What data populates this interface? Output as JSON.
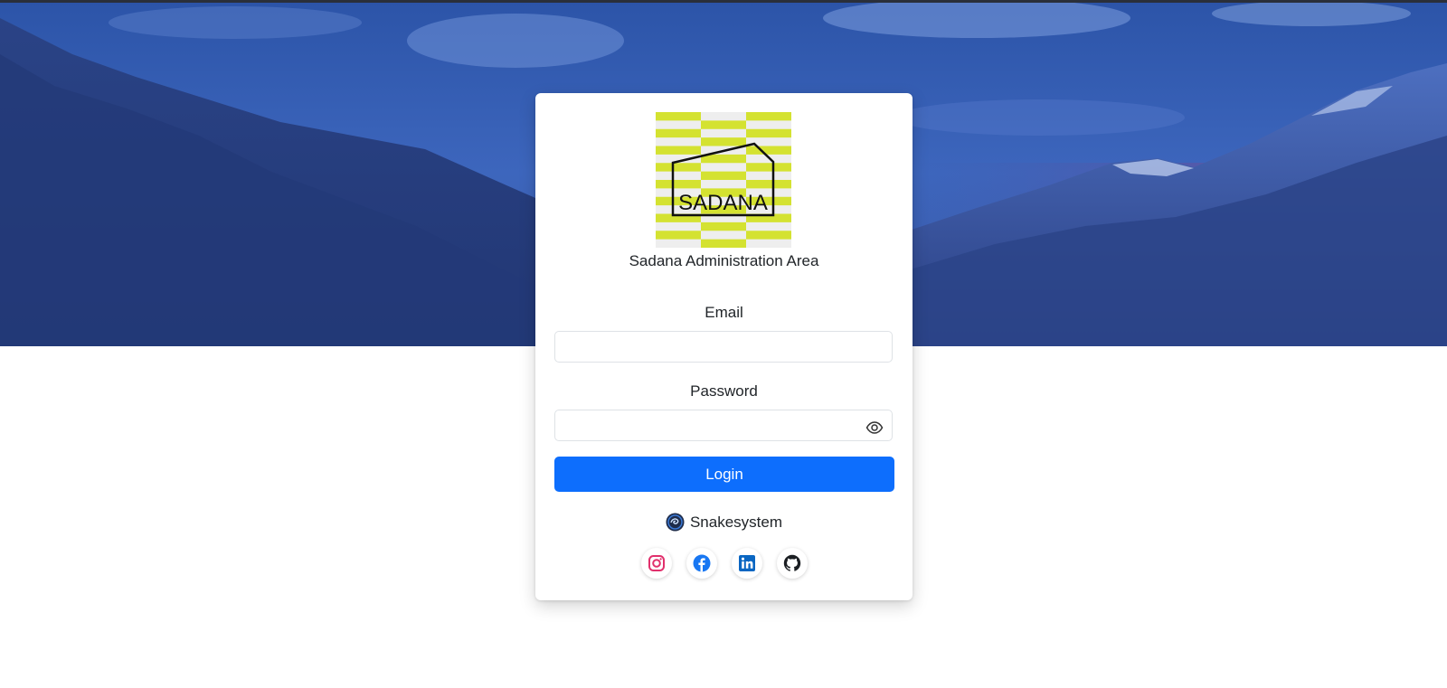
{
  "header": {
    "logo_text": "SADANA",
    "area_title": "Sadana Administration Area"
  },
  "form": {
    "email_label": "Email",
    "email_value": "",
    "password_label": "Password",
    "password_value": "",
    "login_label": "Login"
  },
  "footer": {
    "brand_name": "Snakesystem",
    "brand_icon": "snakesystem-logo-icon",
    "social_links": [
      {
        "icon": "instagram-icon",
        "color": "#e1306c"
      },
      {
        "icon": "facebook-icon",
        "color": "#1877f2"
      },
      {
        "icon": "linkedin-icon",
        "color": "#0a66c2"
      },
      {
        "icon": "github-icon",
        "color": "#1b1f23"
      }
    ]
  },
  "theme": {
    "primary": "#0d6efd",
    "logo_accent": "#d4e231",
    "hero_color": "#2b4a92"
  }
}
